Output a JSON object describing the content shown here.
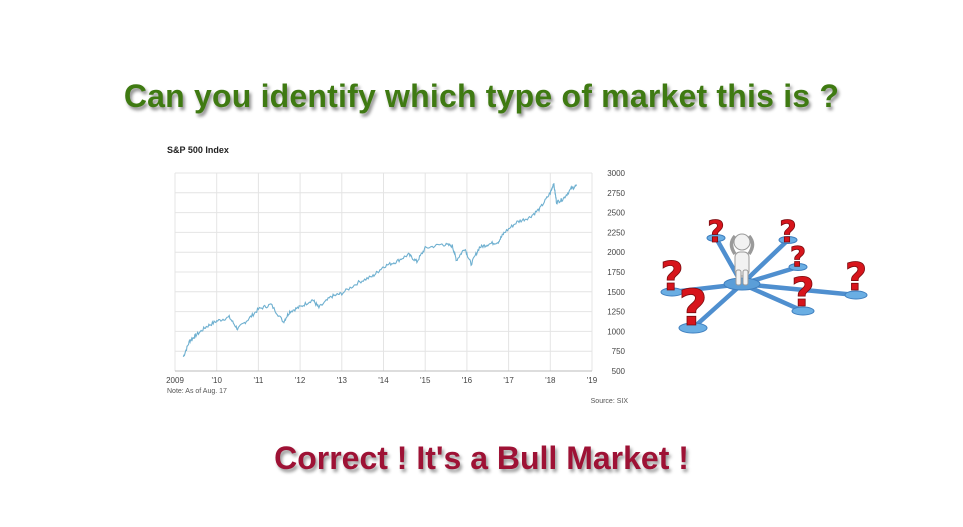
{
  "headline": "Can you identify which type of market this is ?",
  "answer": "Correct ! It's a Bull Market !",
  "colors": {
    "headline": "#3f7a12",
    "answer": "#9e1235",
    "line": "#6fb0d0",
    "grid": "#e4e4e4",
    "question_mark": "#d7151c",
    "hub": "#5b9ed8"
  },
  "illustration": {
    "subject": "person-surrounded-by-question-marks",
    "icons": [
      "person-icon",
      "question-mark-icon"
    ]
  },
  "chart_data": {
    "type": "line",
    "title": "S&P 500 Index",
    "note": "Note: As of Aug. 17",
    "source": "Source: SIX",
    "x_tick_labels": [
      "2009",
      "'10",
      "'11",
      "'12",
      "'13",
      "'14",
      "'15",
      "'16",
      "'17",
      "'18",
      "'19"
    ],
    "x_tick_years": [
      2009,
      2010,
      2011,
      2012,
      2013,
      2014,
      2015,
      2016,
      2017,
      2018,
      2019
    ],
    "y_ticks": [
      500,
      750,
      1000,
      1250,
      1500,
      1750,
      2000,
      2250,
      2500,
      2750,
      3000
    ],
    "xlim": [
      2009,
      2019
    ],
    "ylim": [
      500,
      3000
    ],
    "grid": true,
    "y_axis_side": "right",
    "series": [
      {
        "x": [
          2009.2,
          2009.35,
          2009.5,
          2009.75,
          2010.0,
          2010.3,
          2010.5,
          2010.75,
          2011.0,
          2011.3,
          2011.6,
          2011.75,
          2012.0,
          2012.3,
          2012.45,
          2012.75,
          2013.0,
          2013.4,
          2013.75,
          2014.0,
          2014.3,
          2014.6,
          2014.8,
          2015.0,
          2015.4,
          2015.65,
          2015.75,
          2015.95,
          2016.1,
          2016.3,
          2016.5,
          2016.75,
          2016.9,
          2017.2,
          2017.5,
          2017.75,
          2018.0,
          2018.08,
          2018.15,
          2018.3,
          2018.5,
          2018.63
        ],
        "values": [
          680,
          880,
          950,
          1060,
          1130,
          1180,
          1030,
          1150,
          1280,
          1340,
          1120,
          1250,
          1310,
          1400,
          1300,
          1440,
          1480,
          1620,
          1700,
          1820,
          1880,
          1970,
          1880,
          2050,
          2100,
          2080,
          1900,
          2050,
          1850,
          2060,
          2100,
          2130,
          2250,
          2380,
          2440,
          2550,
          2750,
          2870,
          2630,
          2670,
          2800,
          2840
        ]
      }
    ]
  }
}
